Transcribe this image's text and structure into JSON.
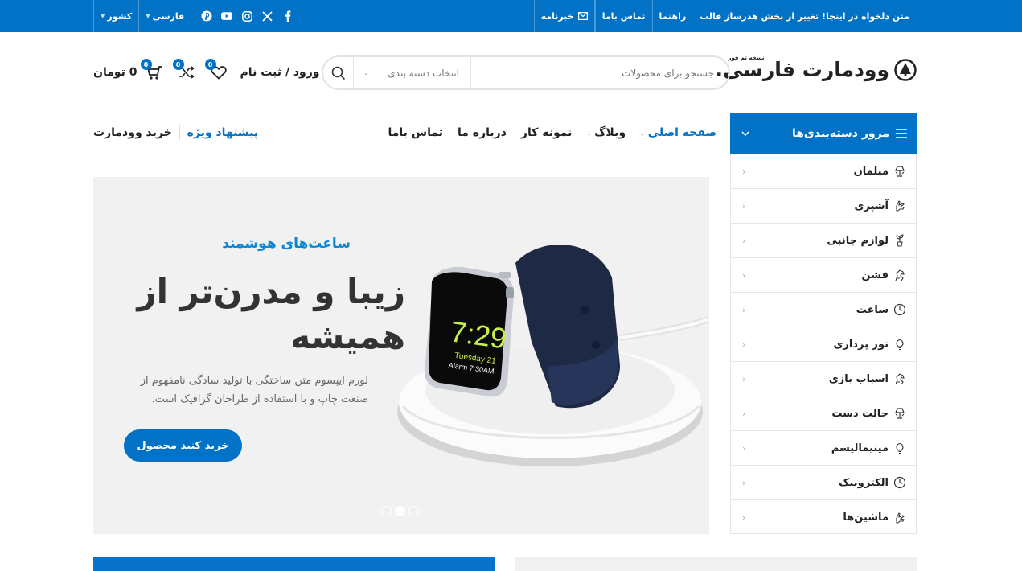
{
  "topbar": {
    "links": [
      "خبرنامه",
      "تماس باما",
      "راهنما"
    ],
    "promo": "متن دلخواه در اینجا! تغییر از بخش هدرساز قالب",
    "language": "فارسی",
    "country": "کشور",
    "social_icons": [
      "facebook-icon",
      "x-icon",
      "instagram-icon",
      "youtube-icon",
      "pinterest-icon"
    ]
  },
  "header": {
    "logo_name": "وودمارت فارسی.",
    "logo_sub": "نسخه تم فور",
    "search_placeholder": "جستجو برای محصولات",
    "category_select": "انتخاب دسته بندی",
    "login": "ورود / ثبت نام",
    "compare_count": "0",
    "wishlist_count": "0",
    "cart_count": "0",
    "cart_total": "0 تومان"
  },
  "nav": {
    "browse_label": "مرور دسته‌بندی‌ها",
    "items": [
      {
        "label": "صفحه اصلی",
        "active": true,
        "caret": true
      },
      {
        "label": "وبلاگ",
        "active": false,
        "caret": true
      },
      {
        "label": "نمونه کار",
        "active": false,
        "caret": false
      },
      {
        "label": "درباره ما",
        "active": false,
        "caret": false
      },
      {
        "label": "تماس باما",
        "active": false,
        "caret": false
      }
    ],
    "special_offer": "پیشنهاد ویژه",
    "buy_woodmart": "خرید وودمارت"
  },
  "categories": [
    {
      "label": "مبلمان",
      "icon": "lamp-icon"
    },
    {
      "label": "آشپزی",
      "icon": "hand-icon"
    },
    {
      "label": "لوازم جانبی",
      "icon": "plant-icon"
    },
    {
      "label": "فشن",
      "icon": "horse-icon"
    },
    {
      "label": "ساعت",
      "icon": "clock-icon"
    },
    {
      "label": "نور پردازی",
      "icon": "bulb-icon"
    },
    {
      "label": "اسباب بازی",
      "icon": "horse-icon"
    },
    {
      "label": "حالت دست",
      "icon": "lamp-icon"
    },
    {
      "label": "مینیمالیسم",
      "icon": "bulb-icon"
    },
    {
      "label": "الکترونیک",
      "icon": "clock-icon"
    },
    {
      "label": "ماشین‌ها",
      "icon": "hand-icon"
    }
  ],
  "hero": {
    "kicker": "ساعت‌های هوشمند",
    "title": "زیبا و مدرن‌تر از همیشه",
    "description": "لورم ایپسوم متن ساختگی با تولید سادگی نامفهوم از صنعت چاپ و با استفاده از طراحان گرافیک است.",
    "cta": "خرید کنید  محصول",
    "watch_time": "7:29",
    "watch_date": "Tuesday 21",
    "watch_alarm": "Alarm 7:30AM",
    "active_slide": 2,
    "slides": 3
  },
  "colors": {
    "brand": "#0272c6",
    "kicker": "#0a86d6"
  }
}
